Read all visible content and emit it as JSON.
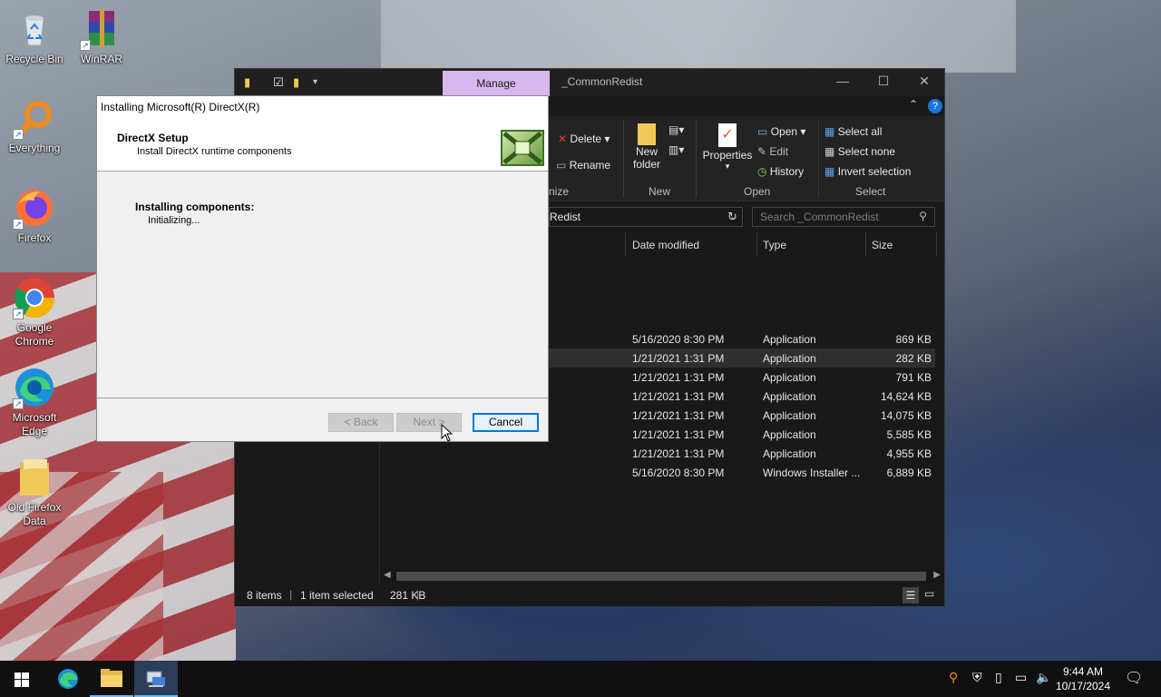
{
  "desktop": {
    "icons": [
      {
        "label": "Recycle Bin",
        "icon": "recycle-bin-icon"
      },
      {
        "label": "WinRAR",
        "icon": "winrar-icon"
      },
      {
        "label": "Everything",
        "icon": "everything-icon"
      },
      {
        "label": "Firefox",
        "icon": "firefox-icon"
      },
      {
        "label": "Google Chrome",
        "icon": "chrome-icon"
      },
      {
        "label": "Microsoft Edge",
        "icon": "edge-icon"
      },
      {
        "label": "Old Firefox Data",
        "icon": "folder-icon"
      }
    ]
  },
  "explorer": {
    "manage_tab": "Manage",
    "title": "_CommonRedist",
    "ribbon": {
      "delete": "Delete",
      "rename": "Rename",
      "organize_partial": "nize",
      "new_folder_line1": "New",
      "new_folder_line2": "folder",
      "new_group": "New",
      "properties": "Properties",
      "open": "Open",
      "edit": "Edit",
      "history": "History",
      "open_group": "Open",
      "select_all": "Select all",
      "select_none": "Select none",
      "invert_selection": "Invert selection",
      "select_group": "Select"
    },
    "address_partial": "Redist",
    "search_placeholder": "Search _CommonRedist",
    "columns": {
      "date": "Date modified",
      "type": "Type",
      "size": "Size"
    },
    "rows": [
      {
        "date": "5/16/2020 8:30 PM",
        "type": "Application",
        "size": "869 KB"
      },
      {
        "date": "1/21/2021 1:31 PM",
        "type": "Application",
        "size": "282 KB"
      },
      {
        "date": "1/21/2021 1:31 PM",
        "type": "Application",
        "size": "791 KB"
      },
      {
        "date": "1/21/2021 1:31 PM",
        "type": "Application",
        "size": "14,624 KB"
      },
      {
        "date": "1/21/2021 1:31 PM",
        "type": "Application",
        "size": "14,075 KB"
      },
      {
        "date": "1/21/2021 1:31 PM",
        "type": "Application",
        "size": "5,585 KB"
      },
      {
        "date": "1/21/2021 1:31 PM",
        "type": "Application",
        "size": "4,955 KB"
      },
      {
        "date": "5/16/2020 8:30 PM",
        "type": "Windows Installer ...",
        "size": "6,889 KB"
      }
    ],
    "status": {
      "items": "8 items",
      "selected": "1 item selected",
      "size": "281 KB"
    }
  },
  "dialog": {
    "title": "Installing Microsoft(R) DirectX(R)",
    "header_title": "DirectX Setup",
    "header_subtitle": "Install DirectX runtime components",
    "section_title": "Installing components:",
    "status": "Initializing...",
    "back": "< Back",
    "next": "Next >",
    "cancel": "Cancel"
  },
  "taskbar": {
    "time": "9:44 AM",
    "date": "10/17/2024"
  }
}
